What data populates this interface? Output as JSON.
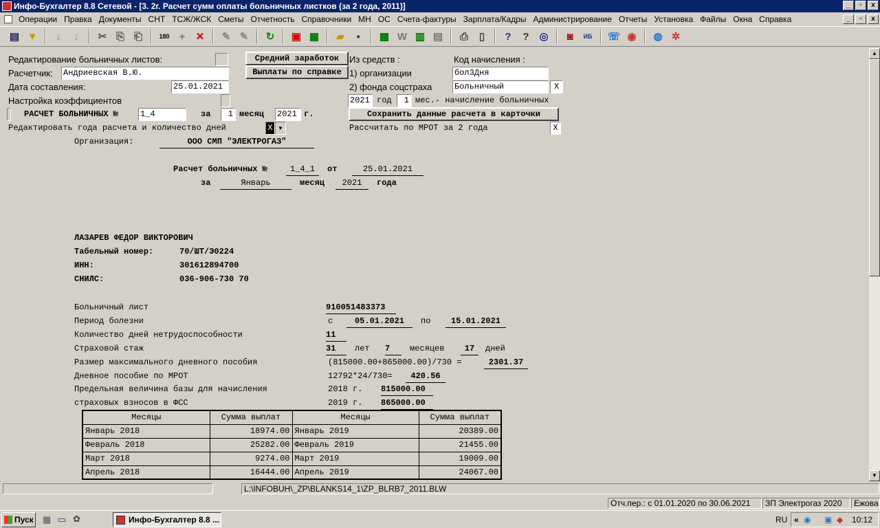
{
  "window": {
    "title": "Инфо-Бухгалтер 8.8 Сетевой - [3. 2г. Расчет сумм оплаты больничных листков (за 2 года, 2011)]",
    "min": "_",
    "max": "▫",
    "close": "x"
  },
  "menu": [
    "Операции",
    "Правка",
    "Документы",
    "СНТ",
    "ТСЖ/ЖСК",
    "Сметы",
    "Отчетность",
    "Справочники",
    "МН",
    "ОС",
    "Счета-фактуры",
    "Зарплата/Кадры",
    "Администрирование",
    "Отчеты",
    "Установка",
    "Файлы",
    "Окна",
    "Справка"
  ],
  "form": {
    "edit_sick_label": "Редактирование больничных листов:",
    "avg_button": "Средний заработок",
    "sources_label": "Из средств :",
    "code_label": "Код начисления :",
    "calculator_label": "Расчетчик:",
    "calculator_value": "Андриевская В.Ю.",
    "payments_button": "Выплаты по справке",
    "src1_label": "1) организации",
    "code1_value": "бол3Дня",
    "date_label": "Дата составления:",
    "date_value": "25.01.2021",
    "src2_label": "2) фонда соцстраха",
    "code2_value": "Больничный",
    "x_mark": "X",
    "coef_label": "Настройка коэффициентов",
    "year_value": "2021",
    "year_label": "год",
    "month_value": "1",
    "month_text": "мес.- начисление больничных",
    "calc_title": "РАСЧЕТ БОЛЬНИЧНЫХ №",
    "calc_no": "1_4",
    "for_label": "за",
    "calc_month": "1",
    "month_label": "месяц",
    "calc_year": "2021",
    "year_abbr": "г.",
    "save_button": "Сохранить данные расчета в карточки",
    "edit_years_label": "Редактировать года расчета и количество дней",
    "mrot_label": "Рассчитать по МРОТ за 2 года"
  },
  "report": {
    "org_label": "Организация:",
    "org_value": "ООО СМП \"ЭЛЕКТРОГАЗ\"",
    "calc_label": "Расчет больничных №",
    "calc_no": "1_4_1",
    "from_label": "от",
    "calc_date": "25.01.2021",
    "for_label": "за",
    "month": "Январь",
    "month_label": "месяц",
    "year": "2021",
    "year_label": "года",
    "employee": "ЛАЗАРЕВ ФЕДОР ВИКТОРОВИЧ",
    "tab_label": "Табельный номер:",
    "tab_value": "70/ШТ/Э0224",
    "inn_label": "ИНН:",
    "inn_value": "301612894700",
    "snils_label": "СНИЛС:",
    "snils_value": "036-906-730 70",
    "sick_label": "Больничный лист",
    "sick_value": "910051483373",
    "period_label": "Период болезни",
    "period_from_label": "с",
    "period_from": "05.01.2021",
    "period_to_label": "по",
    "period_to": "15.01.2021",
    "days_label": "Количество дней нетрудоспособности",
    "days_value": "11",
    "stage_label": "Страховой стаж",
    "stage_years": "31",
    "years_label": "лет",
    "stage_months": "7",
    "months_label": "месяцев",
    "stage_days": "17",
    "days_word": "дней",
    "max_label": "Размер максимального дневного пособия",
    "max_formula": "(815000.00+865000.00)/730 =",
    "max_value": "2301.37",
    "mrot_label": "Дневное пособие по МРОТ",
    "mrot_formula": "12792*24/730=",
    "mrot_value": "420.56",
    "base_label1": "Предельная величина базы для начисления",
    "base_year1": "2018 г.",
    "base_value1": "815000.00",
    "base_label2": "страховых взносов в ФСС",
    "base_year2": "2019 г.",
    "base_value2": "865000.00",
    "table_headers": [
      "Месяцы",
      "Сумма выплат",
      "Месяцы",
      "Сумма выплат"
    ],
    "table_rows": [
      [
        "Январь 2018",
        "18974.00",
        "Январь 2019",
        "20389.00"
      ],
      [
        "Февраль 2018",
        "25282.00",
        "Февраль 2019",
        "21455.00"
      ],
      [
        "Март 2018",
        "9274.00",
        "Март 2019",
        "19009.00"
      ],
      [
        "Апрель 2018",
        "16444.00",
        "Апрель 2019",
        "24067.00"
      ]
    ]
  },
  "status": {
    "path": "L:\\INFOBUH\\_ZP\\BLANKS14_1\\ZP_BLRB7_2011.BLW",
    "period": "Отч.пер.: с 01.01.2020 по 30.06.2021",
    "org": "ЗП Электрогаз 2020",
    "user": "Ежова"
  },
  "taskbar": {
    "start": "Пуск",
    "task": "Инфо-Бухгалтер 8.8 ...",
    "lang": "RU",
    "time": "10:12"
  }
}
